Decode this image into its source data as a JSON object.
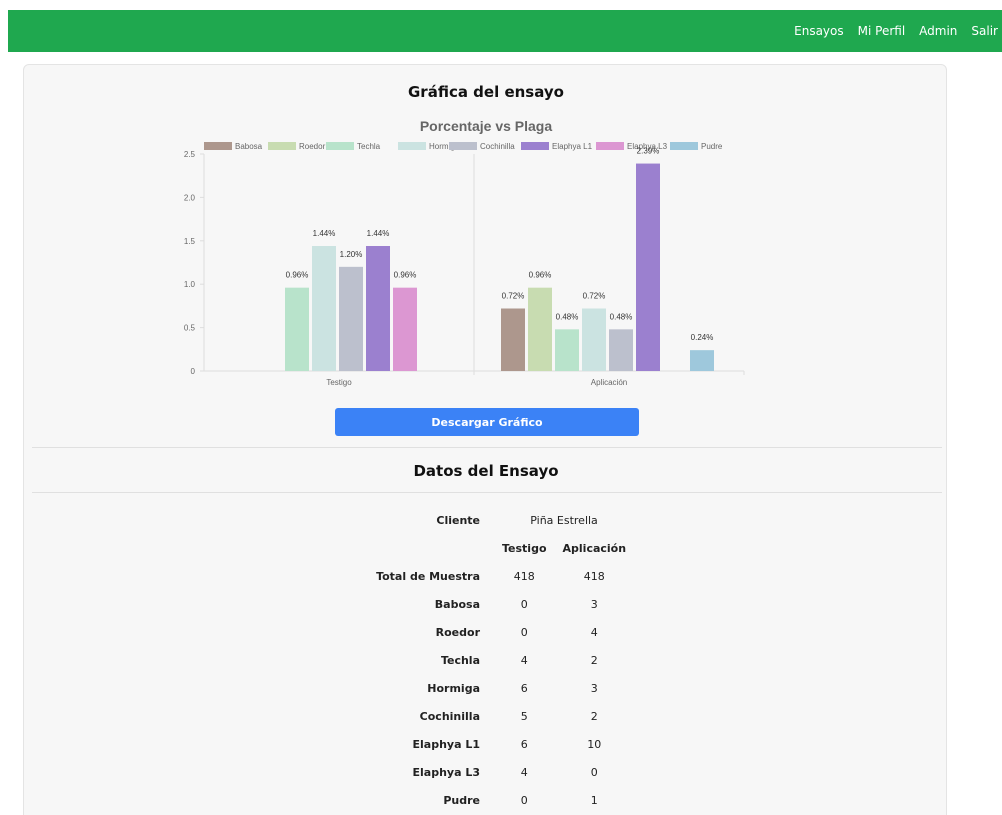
{
  "nav": {
    "links": [
      "Ensayos",
      "Mi Perfil",
      "Admin",
      "Salir"
    ]
  },
  "page": {
    "graph_heading": "Gráfica del ensayo",
    "data_heading": "Datos del Ensayo",
    "download_label": "Descargar Gráfico"
  },
  "chart_data": {
    "type": "bar",
    "title": "Porcentaje vs Plaga",
    "categories": [
      "Testigo",
      "Aplicación"
    ],
    "ylim": [
      0,
      2.5
    ],
    "yticks": [
      "0",
      "0.5",
      "1.0",
      "1.5",
      "2.0",
      "2.5"
    ],
    "legend_position": "top",
    "series": [
      {
        "name": "Babosa",
        "color": "#ad978d",
        "values": [
          0,
          0.72
        ],
        "labels": [
          "",
          "0.72%"
        ]
      },
      {
        "name": "Roedor",
        "color": "#c8dcb1",
        "values": [
          0,
          0.96
        ],
        "labels": [
          "",
          "0.96%"
        ]
      },
      {
        "name": "Techla",
        "color": "#b8e3cb",
        "values": [
          0.96,
          0.48
        ],
        "labels": [
          "0.96%",
          "0.48%"
        ]
      },
      {
        "name": "Hormiga",
        "color": "#cbe3e1",
        "values": [
          1.44,
          0.72
        ],
        "labels": [
          "1.44%",
          "0.72%"
        ]
      },
      {
        "name": "Cochinilla",
        "color": "#bcc0cd",
        "values": [
          1.2,
          0.48
        ],
        "labels": [
          "1.20%",
          "0.48%"
        ]
      },
      {
        "name": "Elaphya L1",
        "color": "#9b80cf",
        "values": [
          1.44,
          2.39
        ],
        "labels": [
          "1.44%",
          "2.39%"
        ]
      },
      {
        "name": "Elaphya L3",
        "color": "#dc97d2",
        "values": [
          0.96,
          0
        ],
        "labels": [
          "0.96%",
          ""
        ]
      },
      {
        "name": "Pudre",
        "color": "#9ec8dc",
        "values": [
          0,
          0.24
        ],
        "labels": [
          "",
          "0.24%"
        ]
      }
    ]
  },
  "table": {
    "cliente_label": "Cliente",
    "cliente_value": "Piña Estrella",
    "col_testigo": "Testigo",
    "col_aplicacion": "Aplicación",
    "rows": [
      {
        "label": "Total de Muestra",
        "testigo": "418",
        "aplicacion": "418"
      },
      {
        "label": "Babosa",
        "testigo": "0",
        "aplicacion": "3"
      },
      {
        "label": "Roedor",
        "testigo": "0",
        "aplicacion": "4"
      },
      {
        "label": "Techla",
        "testigo": "4",
        "aplicacion": "2"
      },
      {
        "label": "Hormiga",
        "testigo": "6",
        "aplicacion": "3"
      },
      {
        "label": "Cochinilla",
        "testigo": "5",
        "aplicacion": "2"
      },
      {
        "label": "Elaphya L1",
        "testigo": "6",
        "aplicacion": "10"
      },
      {
        "label": "Elaphya L3",
        "testigo": "4",
        "aplicacion": "0"
      },
      {
        "label": "Pudre",
        "testigo": "0",
        "aplicacion": "1"
      }
    ]
  }
}
